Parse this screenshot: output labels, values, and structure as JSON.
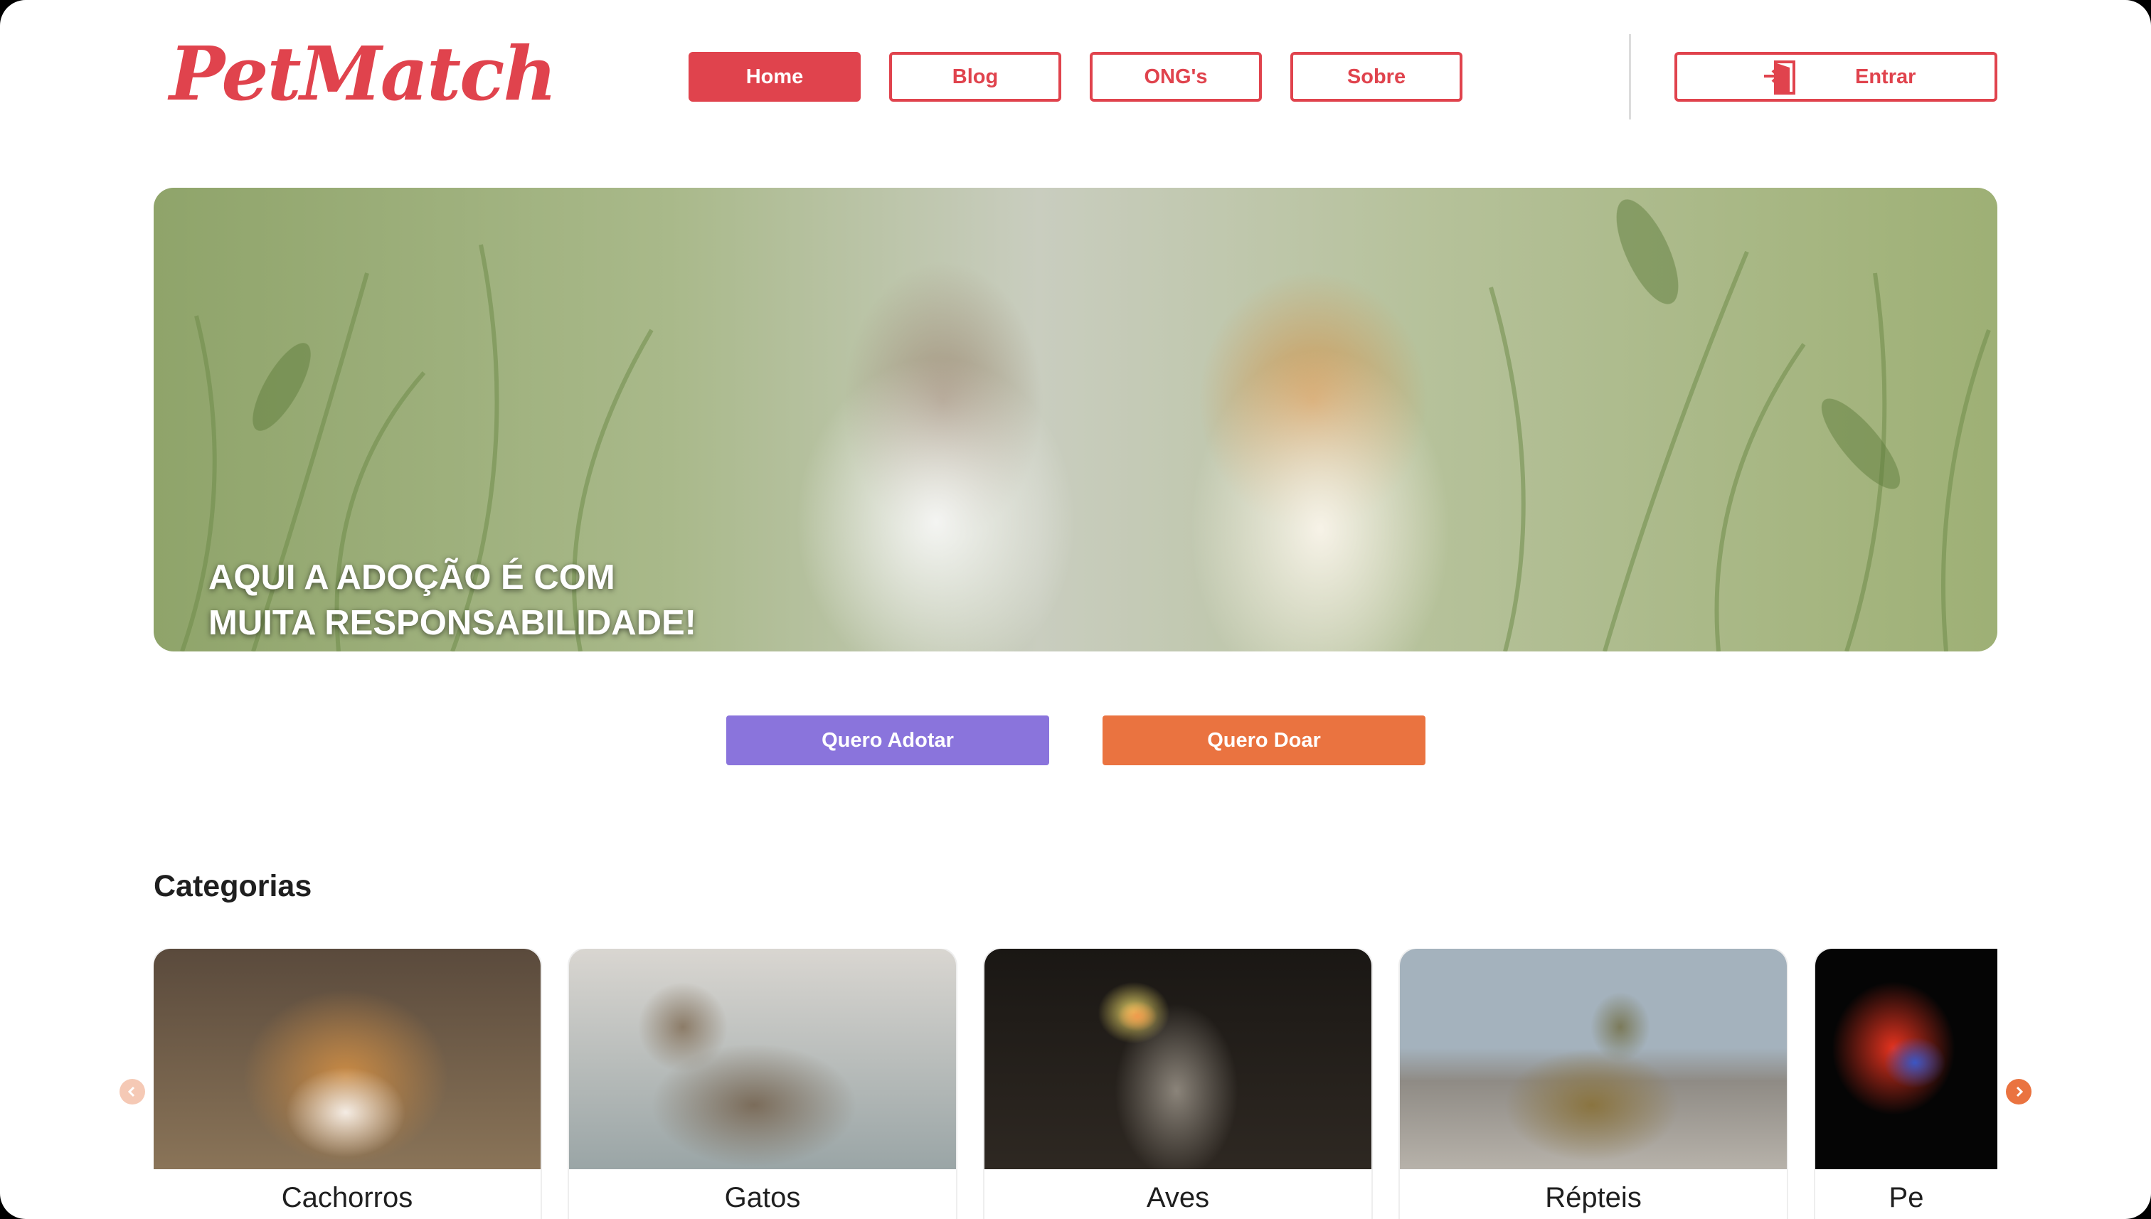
{
  "header": {
    "logo": "PetMatch",
    "nav": [
      {
        "label": "Home",
        "active": true
      },
      {
        "label": "Blog",
        "active": false
      },
      {
        "label": "ONG's",
        "active": false
      },
      {
        "label": "Sobre",
        "active": false
      }
    ],
    "login_label": "Entrar",
    "login_icon": "login-door-icon"
  },
  "hero": {
    "line1": "AQUI A ADOÇÃO É COM",
    "line2": "MUITA RESPONSABILIDADE!"
  },
  "actions": {
    "adopt_label": "Quero Adotar",
    "donate_label": "Quero Doar"
  },
  "categories": {
    "title": "Categorias",
    "items": [
      {
        "label": "Cachorros"
      },
      {
        "label": "Gatos"
      },
      {
        "label": "Aves"
      },
      {
        "label": "Répteis"
      },
      {
        "label": "Pe"
      }
    ],
    "prev_icon": "chevron-left-icon",
    "next_icon": "chevron-right-icon"
  },
  "colors": {
    "brand": "#e0434d",
    "adopt": "#8a74dc",
    "donate": "#ea7340",
    "arrow_active": "#ea7340",
    "arrow_disabled": "#f5c9b5"
  }
}
